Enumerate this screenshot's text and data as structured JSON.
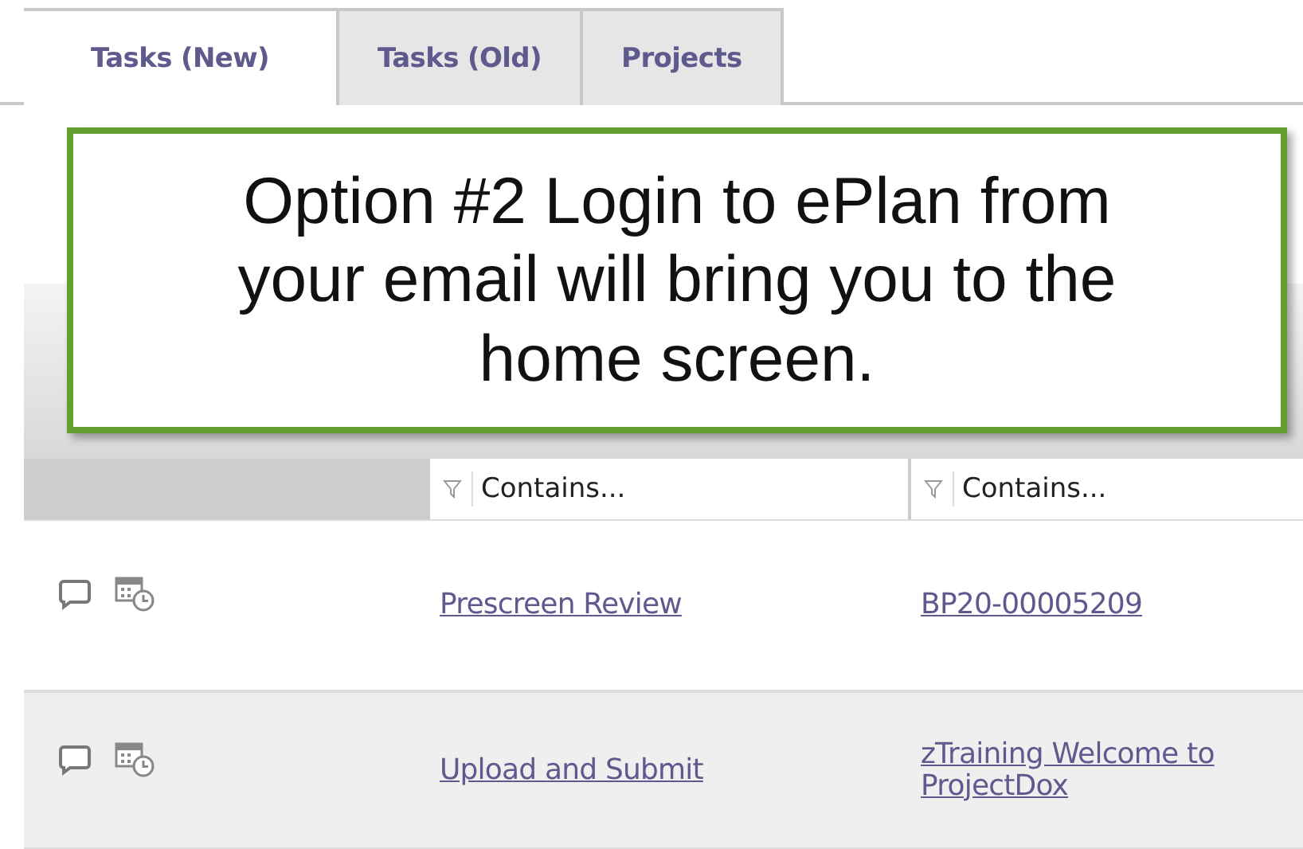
{
  "tabs": [
    {
      "label": "Tasks (New)",
      "selected": true
    },
    {
      "label": "Tasks (Old)",
      "selected": false
    },
    {
      "label": "Projects",
      "selected": false
    }
  ],
  "callout": {
    "text": "Option #2 Login to ePlan from your email will bring you to the home screen."
  },
  "filters": [
    {
      "placeholder": "Contains..."
    },
    {
      "placeholder": "Contains..."
    }
  ],
  "rows": [
    {
      "task": "Prescreen Review",
      "project": [
        "BP20-00005209"
      ]
    },
    {
      "task": "Upload and Submit",
      "project": [
        "zTraining Welcome to",
        "ProjectDox"
      ]
    }
  ]
}
